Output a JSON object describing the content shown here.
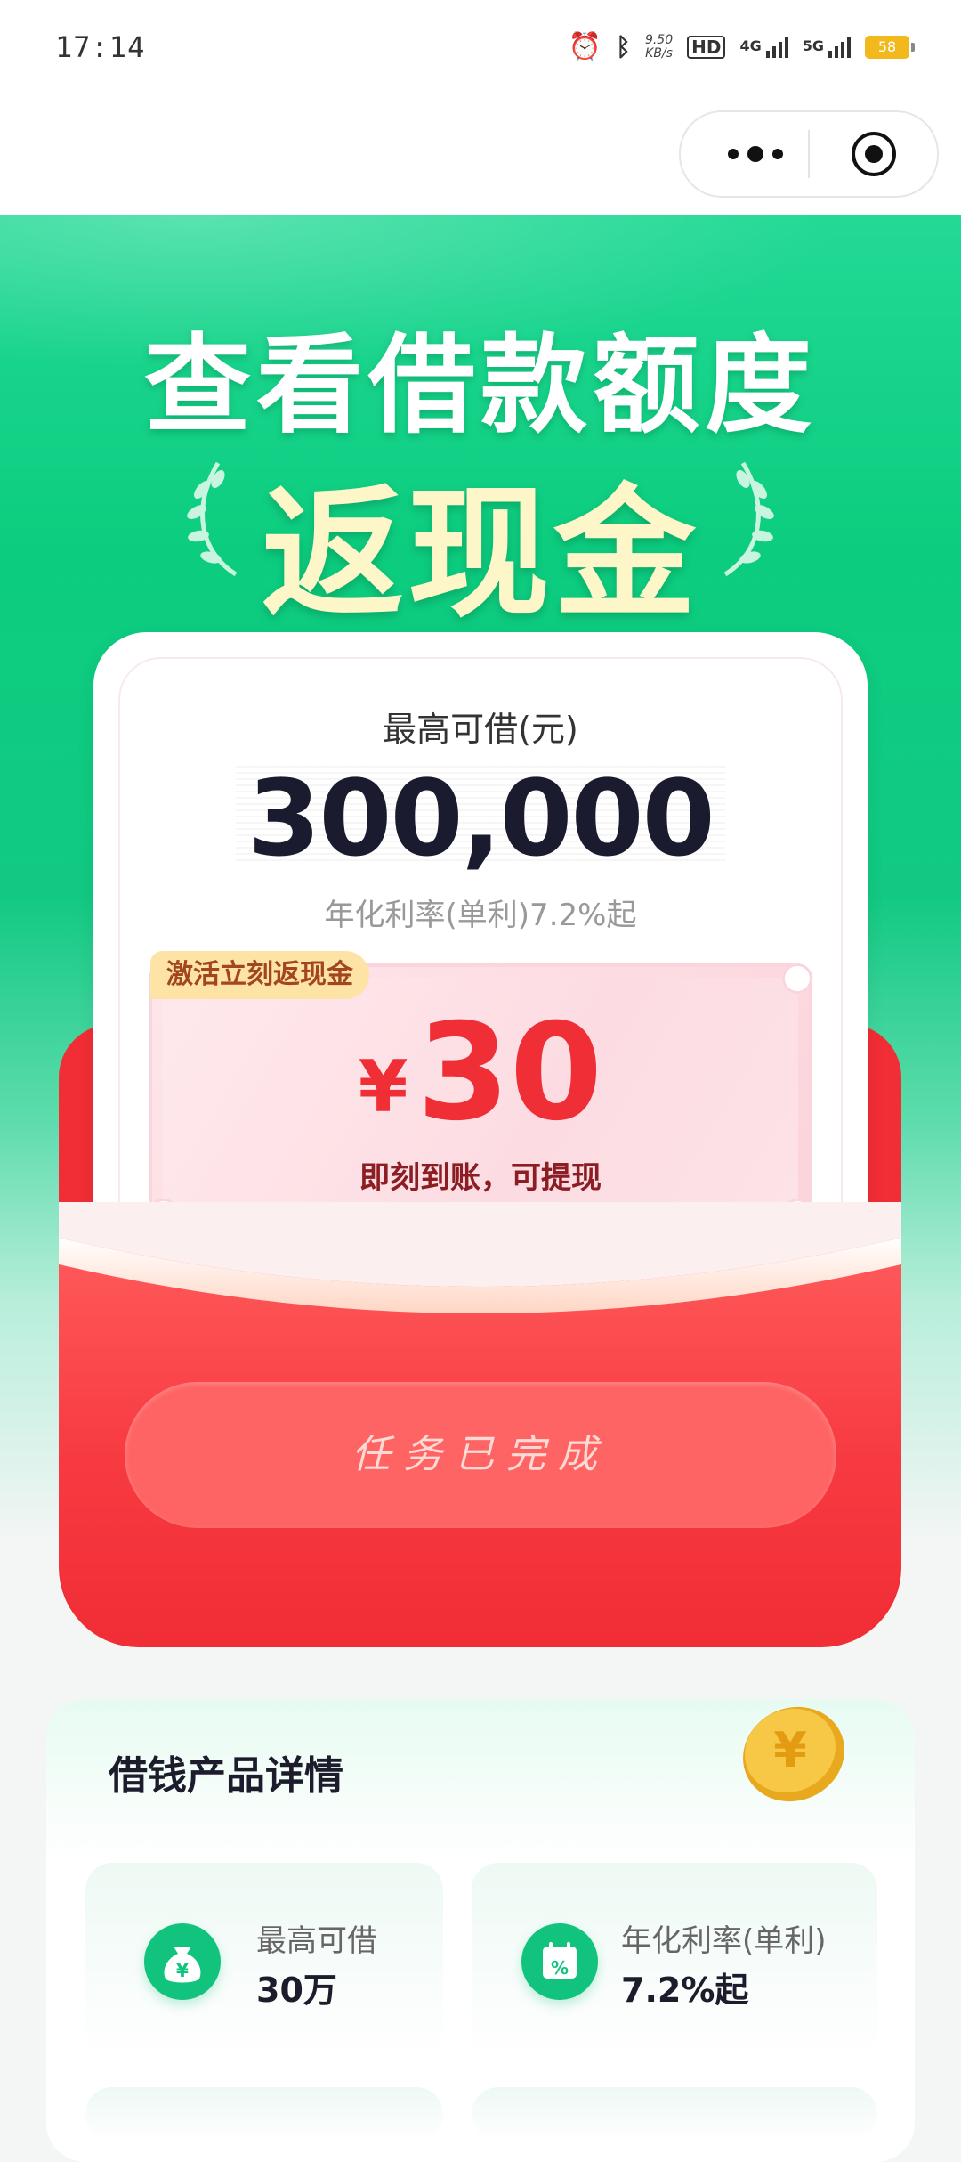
{
  "status_bar": {
    "time": "17:14",
    "net_speed_value": "9.50",
    "net_speed_unit": "KB/s",
    "hd": "HD",
    "signal_1": "4G",
    "signal_2": "5G",
    "battery": "58"
  },
  "hero": {
    "title": "查看借款额度",
    "subtitle": "返现金"
  },
  "credit_card": {
    "label": "最高可借(元)",
    "amount": "300,000",
    "rate_text": "年化利率(单利)7.2%起"
  },
  "cashback": {
    "tag": "激活立刻返现金",
    "currency": "¥",
    "amount": "30",
    "note": "即刻到账，可提现"
  },
  "task_button": {
    "label": "任务已完成"
  },
  "details": {
    "title": "借钱产品详情",
    "items": [
      {
        "label": "最高可借",
        "value": "30万",
        "icon": "money-bag-icon"
      },
      {
        "label": "年化利率(单利)",
        "value": "7.2%起",
        "icon": "calendar-percent-icon"
      }
    ]
  },
  "colors": {
    "brand_green": "#12c37e",
    "envelope_red": "#f12d35",
    "title_cream": "#fdf6c8"
  }
}
